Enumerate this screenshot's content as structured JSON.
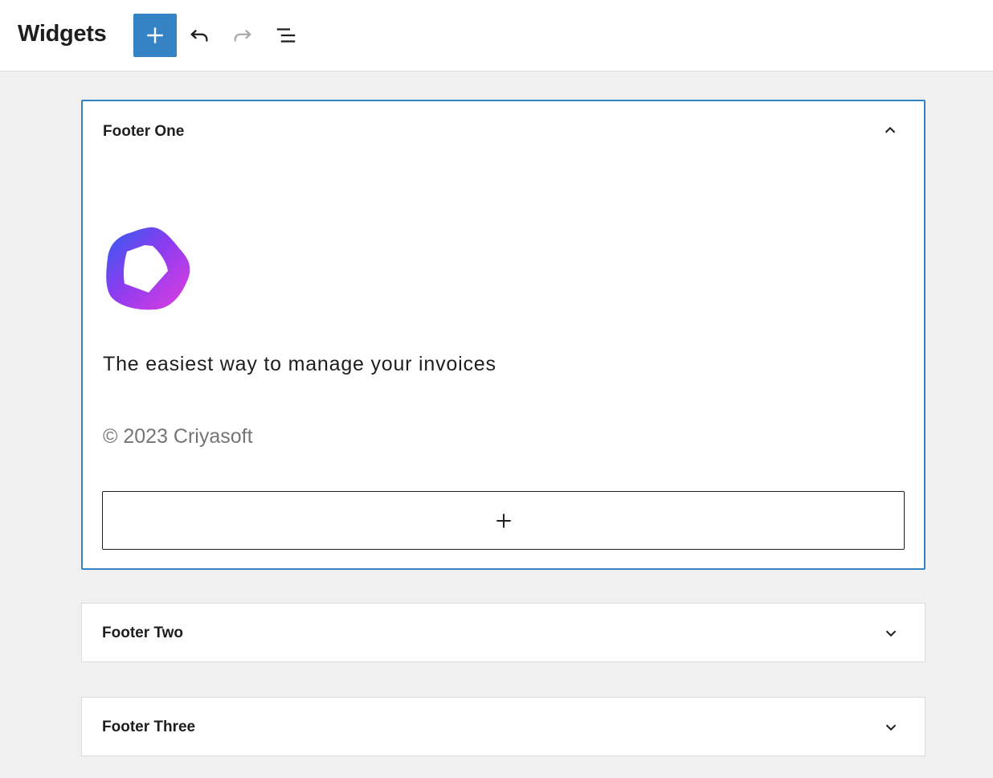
{
  "header": {
    "title": "Widgets",
    "buttons": {
      "add": "plus-icon",
      "undo": "undo-icon",
      "redo": "redo-icon",
      "list_view": "list-view-icon"
    }
  },
  "widget_areas": [
    {
      "title": "Footer One",
      "expanded": true,
      "blocks": {
        "tagline": "The easiest way to manage your invoices",
        "copyright": "© 2023 Criyasoft"
      }
    },
    {
      "title": "Footer Two",
      "expanded": false
    },
    {
      "title": "Footer Three",
      "expanded": false
    }
  ],
  "colors": {
    "accent": "#3582c4",
    "text": "#1e1e1e",
    "muted": "#757575",
    "canvas": "#f0f0f0"
  }
}
